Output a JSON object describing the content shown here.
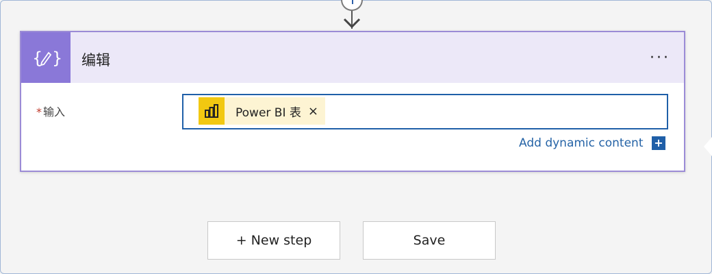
{
  "card": {
    "title": "编辑",
    "more_label": "···",
    "icon": "code-braces-icon"
  },
  "input_field": {
    "required_mark": "*",
    "label": "输入",
    "token": {
      "label": "Power BI 表",
      "close": "×",
      "icon": "power-bi-icon"
    }
  },
  "dynamic_content": {
    "link_label": "Add dynamic content",
    "plus": "+"
  },
  "buttons": {
    "new_step": "+ New step",
    "save": "Save"
  },
  "colors": {
    "header_bg": "#ece8f8",
    "icon_bg": "#8a78d8",
    "card_border": "#9b8bd6",
    "input_border": "#1f5fa8",
    "token_bg": "#fdf4d3",
    "token_icon_bg": "#f2c811",
    "link": "#2563a6"
  }
}
